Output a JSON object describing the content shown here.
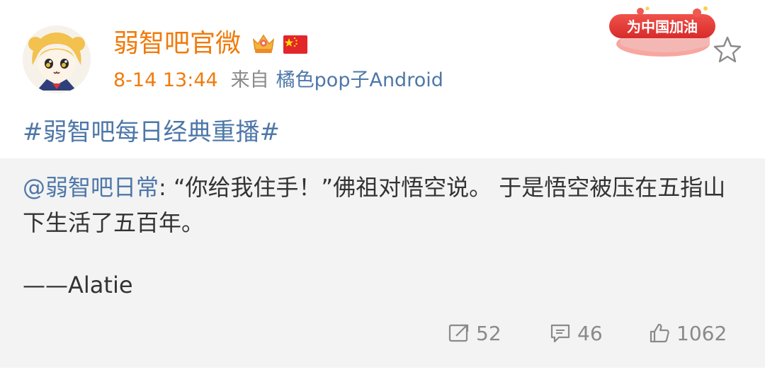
{
  "header": {
    "username": "弱智吧官微",
    "timestamp": "8-14 13:44",
    "from_label": "来自",
    "source": "橘色pop子Android",
    "badge_text": "为中国加油",
    "icons": [
      "vip-crown-icon",
      "china-flag-icon",
      "star-icon"
    ]
  },
  "post": {
    "topic": "#弱智吧每日经典重播#"
  },
  "retweet": {
    "mention": "@弱智吧日常",
    "separator": ": ",
    "text": "“你给我住手！”佛祖对悟空说。 于是悟空被压在五指山下生活了五百年。",
    "author": "——Alatie",
    "actions": {
      "reposts": "52",
      "comments": "46",
      "likes": "1062"
    }
  },
  "colors": {
    "username": "#f07b0c",
    "link": "#4e77a8",
    "retweet_bg": "#f3f3f3",
    "meta_gray": "#8a8a8a",
    "badge_red": "#e8322e"
  }
}
